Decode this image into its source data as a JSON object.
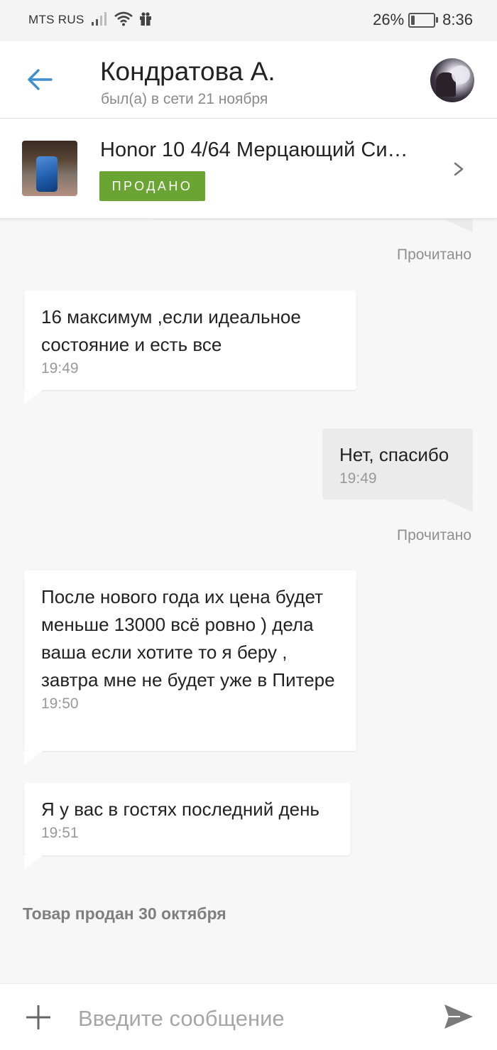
{
  "status_bar": {
    "carrier": "MTS RUS",
    "battery": "26%",
    "battery_level": 0.26,
    "time": "8:36"
  },
  "header": {
    "title": "Кондратова А.",
    "subtitle": "был(а) в сети 21 ноября",
    "icons": {
      "back": "arrow-left-icon",
      "avatar": "avatar"
    },
    "accent": "#3f8fd0"
  },
  "product": {
    "title": "Honor 10 4/64 Мерцающий Си…",
    "badge": "ПРОДАНО",
    "badge_color": "#6aa533"
  },
  "chat": {
    "read_label_1": "Прочитано",
    "message_1": {
      "text": "16 максимум ,если идеальное состояние и есть все",
      "time": "19:49"
    },
    "message_2": {
      "text": "Нет, спасибо",
      "time": "19:49"
    },
    "read_label_2": "Прочитано",
    "message_3": {
      "text": "После нового года их цена будет меньше 13000 всё ровно ) дела ваша если хотите то я беру , завтра мне не будет уже в Питере",
      "time": "19:50"
    },
    "message_4": {
      "text": "Я у вас в гостях последний день",
      "time": "19:51"
    },
    "notice": "Товар продан 30 октября"
  },
  "input_bar": {
    "placeholder": "Введите сообщение",
    "icons": {
      "add": "plus-icon",
      "send": "send-icon"
    }
  }
}
